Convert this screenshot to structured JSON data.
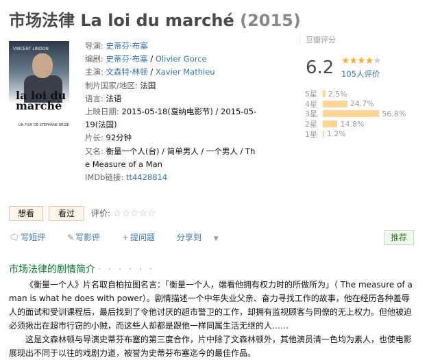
{
  "title": {
    "main": "市场法律 La loi du marché",
    "year": "(2015)"
  },
  "poster": {
    "actor": "VINCENT LINDON",
    "title": "la loi du marché",
    "director": "UN FILM DE STÉPHANE BRIZÉ"
  },
  "info": {
    "director_label": "导演:",
    "director": "史蒂芬·布塞",
    "writer_label": "编剧:",
    "writer1": "史蒂芬·布塞",
    "writer2": "Olivier Gorce",
    "cast_label": "主演:",
    "cast1": "文森特·林顿",
    "cast2": "Xavier Mathieu",
    "country_label": "制片国家/地区:",
    "country": "法国",
    "lang_label": "语言:",
    "lang": "法语",
    "release_label": "上映日期:",
    "release1": "2015-05-18(戛纳电影节) / 2015-05-",
    "release2": "19(法国)",
    "runtime_label": "片长:",
    "runtime": "92分钟",
    "aka_label": "又名:",
    "aka1": "衡量一个人(台) / 简单男人 / 一个男人 / Th",
    "aka2": "e Measure of a Man",
    "imdb_label": "IMDb链接:",
    "imdb": "tt4428814"
  },
  "rating": {
    "label": "豆瓣评分",
    "score": "6.2",
    "votes": "105人评价",
    "rows": [
      {
        "label": "5星",
        "pct": "2.5%",
        "value": 2.5
      },
      {
        "label": "4星",
        "pct": "24.7%",
        "value": 24.7
      },
      {
        "label": "3星",
        "pct": "56.8%",
        "value": 56.8
      },
      {
        "label": "2星",
        "pct": "14.8%",
        "value": 14.8
      },
      {
        "label": "1星",
        "pct": "1.2%",
        "value": 1.2
      }
    ]
  },
  "buttons": {
    "want": "想看",
    "seen": "看过",
    "rate_label": "评价:"
  },
  "actions": {
    "short": "写短评",
    "review": "写影评",
    "ask": "提问题",
    "share": "分享到",
    "recommend": "推荐"
  },
  "summary": {
    "heading": "市场法律的剧情简介",
    "dots": "· · · · · ·",
    "p1": "《衡量一个人》片名取自柏拉图名言：「衡量一个人，端看他拥有权力时的所做所为」（ The measure of a man is what he does with power）。剧情描述一个中年失业父亲、奋力寻找工作的故事，他在经历各种羞辱人的面试和受训课程后，最后找到了令他讨厌的超市警卫的工作，却拥有监视顾客与同僚的无上权力。但他被迫必须揪出在超市行窃的小贼，而这些人却都是跟他一样同属生活无继的人……",
    "p2": "这是文森林顿与导演史蒂芬布塞的第三度合作，片中除了文森林顿外，其他演员清一色均为素人，也使电影展现出不同于以往的戏剧力道，被誉为史蒂芬布塞迄今的最佳作品。"
  }
}
